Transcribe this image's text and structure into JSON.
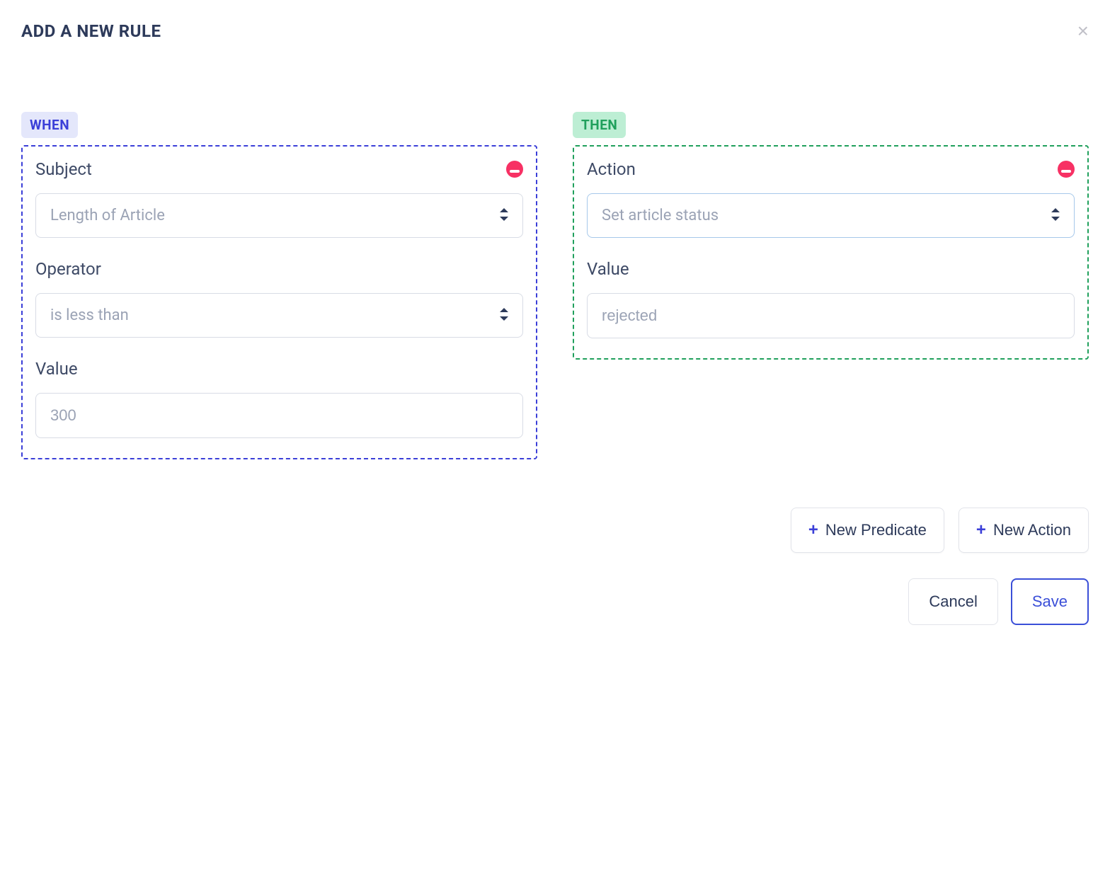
{
  "title": "ADD A NEW RULE",
  "when": {
    "badge": "WHEN",
    "subject": {
      "label": "Subject",
      "value": "Length of Article"
    },
    "operator": {
      "label": "Operator",
      "value": "is less than"
    },
    "value": {
      "label": "Value",
      "value": "300"
    }
  },
  "then": {
    "badge": "THEN",
    "action": {
      "label": "Action",
      "value": "Set article status"
    },
    "value": {
      "label": "Value",
      "value": "rejected"
    }
  },
  "buttons": {
    "new_predicate": "New Predicate",
    "new_action": "New Action",
    "cancel": "Cancel",
    "save": "Save"
  }
}
